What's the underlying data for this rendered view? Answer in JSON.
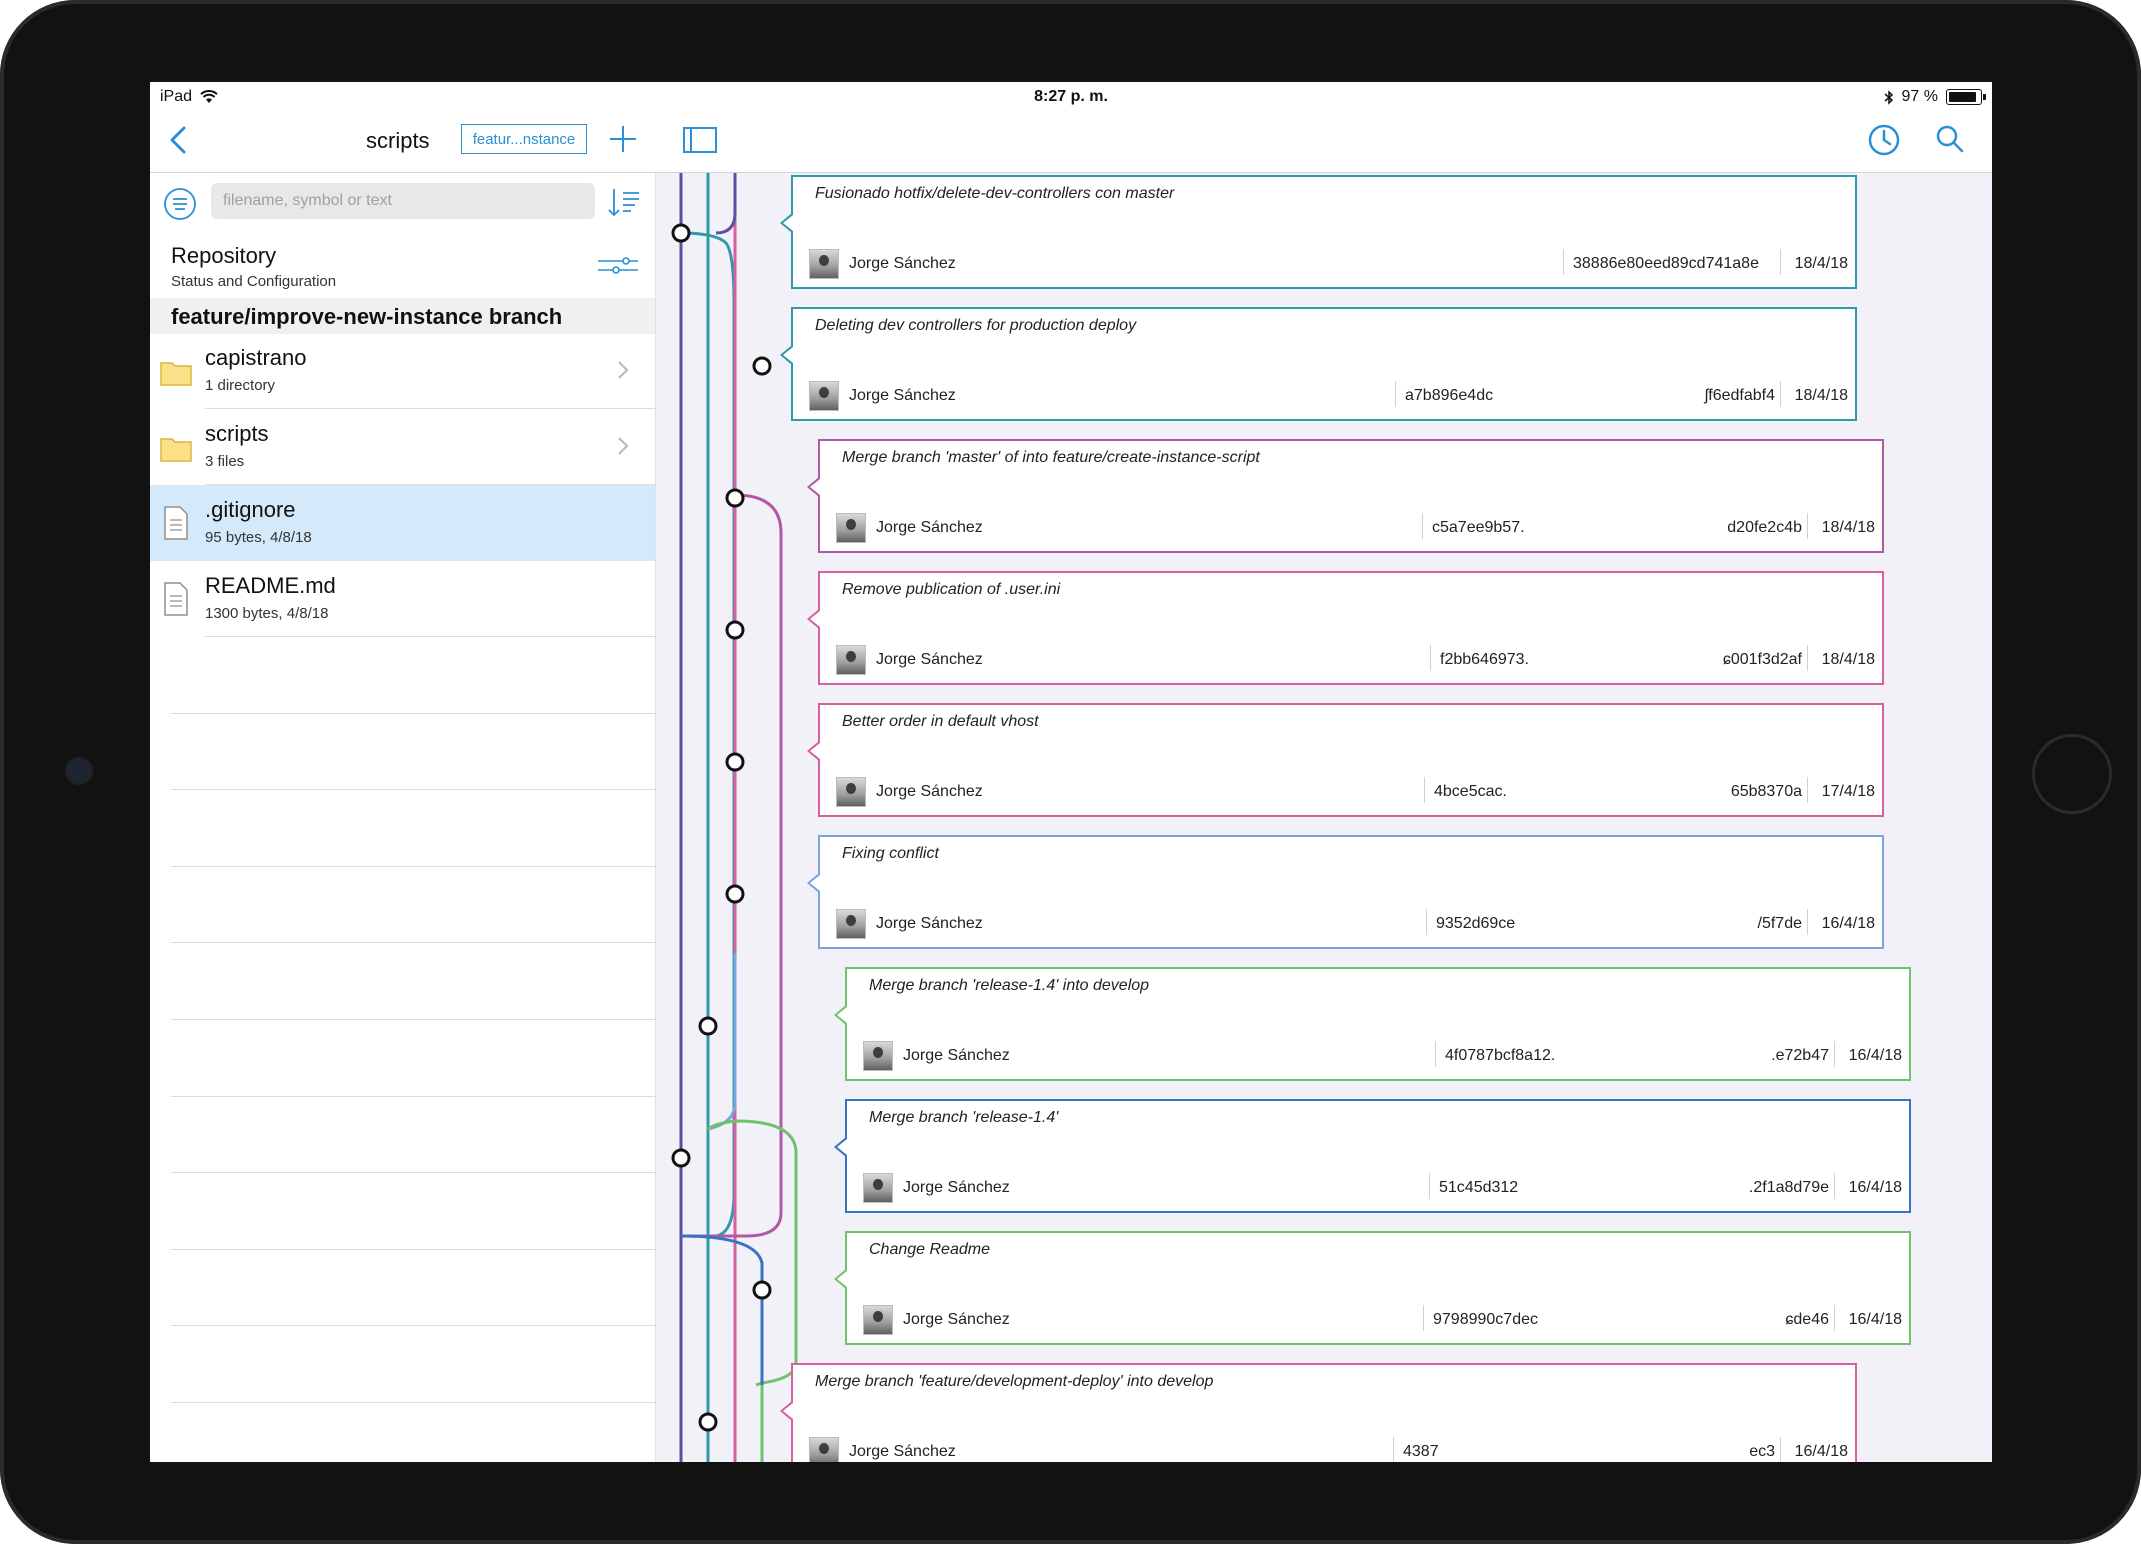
{
  "status_bar": {
    "device": "iPad",
    "time": "8:27 p. m.",
    "battery": "97 %"
  },
  "nav": {
    "title": "scripts",
    "branch_chip": "featur...nstance"
  },
  "search": {
    "placeholder": "filename, symbol or text"
  },
  "repository": {
    "title": "Repository",
    "subtitle": "Status and Configuration"
  },
  "branch_header": "feature/improve-new-instance branch",
  "files": [
    {
      "name": "capistrano",
      "meta": "1 directory",
      "type": "folder"
    },
    {
      "name": "scripts",
      "meta": "3 files",
      "type": "folder"
    },
    {
      "name": ".gitignore",
      "meta": "95 bytes, 4/8/18",
      "type": "file",
      "selected": true
    },
    {
      "name": "README.md",
      "meta": "1300 bytes, 4/8/18",
      "type": "file"
    }
  ],
  "commits": [
    {
      "message": "Fusionado hotfix/delete-dev-controllers con master",
      "author": "Jorge Sánchez",
      "hash": "38886e80eed89cd741a8e",
      "hash_end": "",
      "date": "18/4/18",
      "color": "#2e9aa8"
    },
    {
      "message": "Deleting dev controllers for production deploy",
      "author": "Jorge Sánchez",
      "hash": "a7b896e4dc",
      "hash_end": "ʃf6edfabf4",
      "date": "18/4/18",
      "color": "#2e9aa8"
    },
    {
      "message": "Merge branch 'master' of                                              into feature/create-instance-script",
      "author": "Jorge Sánchez",
      "hash": "c5a7ee9b57.",
      "hash_end": "d20fe2c4b",
      "date": "18/4/18",
      "color": "#b05aa6"
    },
    {
      "message": "Remove publication of .user.ini",
      "author": "Jorge Sánchez",
      "hash": "f2bb646973.",
      "hash_end": "ɕ001f3d2af",
      "date": "18/4/18",
      "color": "#d760a0"
    },
    {
      "message": "Better order in default vhost",
      "author": "Jorge Sánchez",
      "hash": "4bce5cac.",
      "hash_end": "65b8370a",
      "date": "17/4/18",
      "color": "#d760a0"
    },
    {
      "message": "Fixing conflict",
      "author": "Jorge Sánchez",
      "hash": "9352d69ce",
      "hash_end": "/5f7de",
      "date": "16/4/18",
      "color": "#7aa6dd"
    },
    {
      "message": "Merge branch 'release-1.4' into develop",
      "author": "Jorge Sánchez",
      "hash": "4f0787bcf8a12.",
      "hash_end": ".e72b47",
      "date": "16/4/18",
      "color": "#6ec26c"
    },
    {
      "message": "Merge branch 'release-1.4'",
      "author": "Jorge Sánchez",
      "hash": "51c45d312",
      "hash_end": ".2f1a8d79e",
      "date": "16/4/18",
      "color": "#3a72c2"
    },
    {
      "message": "Change Readme",
      "author": "Jorge Sánchez",
      "hash": "9798990c7dec",
      "hash_end": "ɕde46",
      "date": "16/4/18",
      "color": "#6ec26c"
    },
    {
      "message": "Merge branch 'feature/development-deploy' into develop",
      "author": "Jorge Sánchez",
      "hash": "4387",
      "hash_end": "ec3",
      "date": "16/4/18",
      "color": "#d760a0"
    }
  ]
}
